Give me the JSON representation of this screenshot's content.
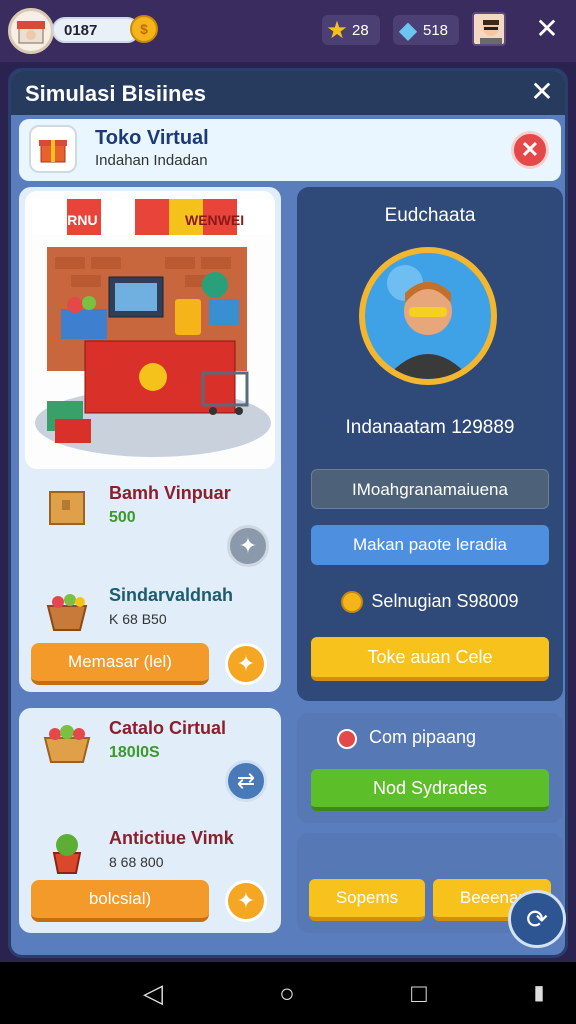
{
  "hud": {
    "coin_value": "0187",
    "coin_symbol": "$",
    "stars": "28",
    "gems": "518",
    "close": "✕"
  },
  "modal": {
    "title": "Simulasi Bisiines",
    "close": "✕"
  },
  "shop": {
    "name": "Toko Virtual",
    "subtitle": "Indahan Indadan",
    "remove": "✕"
  },
  "scene": {
    "awning_left": "VORNU",
    "awning_right": "WENWEI"
  },
  "items": [
    {
      "name": "Bamh Vinpuar",
      "value": "500"
    },
    {
      "name": "Sindarvaldnah",
      "value": "K 68    B50"
    },
    {
      "name": "Catalo Cirtual",
      "value": "180l0S"
    },
    {
      "name": "Antictiue Vimk",
      "value": "8 68    800"
    }
  ],
  "buttons": {
    "left_primary": "Memasar (lel)",
    "left_secondary": "bolcsial)"
  },
  "profile": {
    "title": "Eudchaata",
    "stat": "Indanaatam  129889",
    "slot_dark": "IMoahgranamaiuena",
    "slot_blue": "Makan paote leradia",
    "money": "Selnugian  S98009",
    "slot_yellow": "Toke auan Cele"
  },
  "upgrade": {
    "label": "Com pipaang",
    "button": "Nod Sydrades"
  },
  "bottom": {
    "left_btn": "Sopems",
    "right_btn": "Beeenar"
  },
  "nav": {
    "back": "◁",
    "home": "○",
    "recent": "□"
  }
}
